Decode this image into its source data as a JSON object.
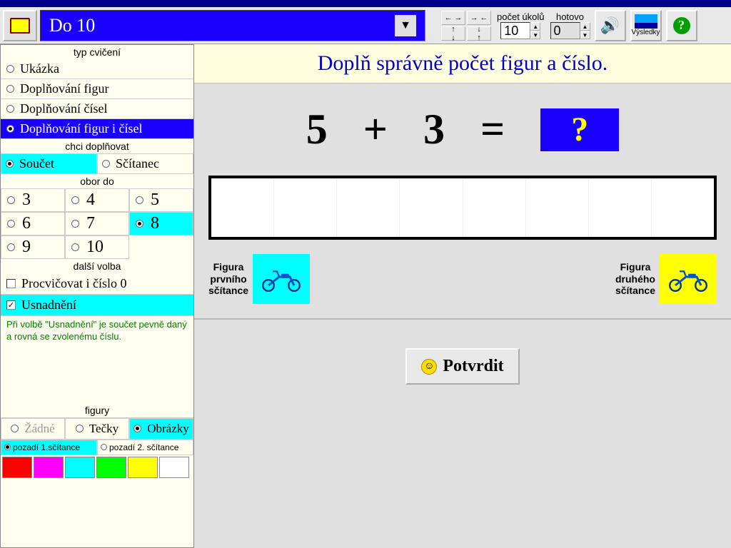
{
  "category": "Do 10",
  "stats": {
    "tasks_label": "počet úkolů",
    "tasks_value": "10",
    "done_label": "hotovo",
    "done_value": "0"
  },
  "results_label": "Výsledky",
  "sidebar": {
    "exercise_type": {
      "title": "typ cvičení",
      "options": [
        "Ukázka",
        "Doplňování figur",
        "Doplňování čísel",
        "Doplňování figur i čísel"
      ],
      "selected": 3
    },
    "fill_mode": {
      "title": "chci doplňovat",
      "options": [
        "Součet",
        "Sčítanec"
      ],
      "selected": 0
    },
    "range": {
      "title": "obor do",
      "options": [
        "3",
        "4",
        "5",
        "6",
        "7",
        "8",
        "9",
        "10"
      ],
      "selected": 5
    },
    "more": {
      "title": "další volba",
      "practice_zero": "Procvičovat i číslo 0",
      "practice_zero_checked": false,
      "ease": "Usnadnění",
      "ease_checked": true,
      "hint": "Při volbě \"Usnadnění\" je součet pevně daný a rovná se zvolenému číslu."
    },
    "figures": {
      "title": "figury",
      "options": [
        "Žádné",
        "Tečky",
        "Obrázky"
      ],
      "disabled": [
        true,
        false,
        false
      ],
      "selected": 2
    },
    "bg": {
      "options": [
        "pozadí 1.sčítance",
        "pozadí 2. sčítance"
      ],
      "selected": 0
    },
    "colors": [
      "#ff0000",
      "#ff00ff",
      "#00ffff",
      "#00ff00",
      "#ffff00",
      "#ffffff"
    ]
  },
  "content": {
    "instruction": "Doplň správně počet figur a číslo.",
    "equation": {
      "a": "5",
      "op": "+",
      "b": "3",
      "eq": "=",
      "answer": "?"
    },
    "fig1_label": "Figura prvního sčítance",
    "fig2_label": "Figura druhého sčítance",
    "confirm": "Potvrdit"
  }
}
